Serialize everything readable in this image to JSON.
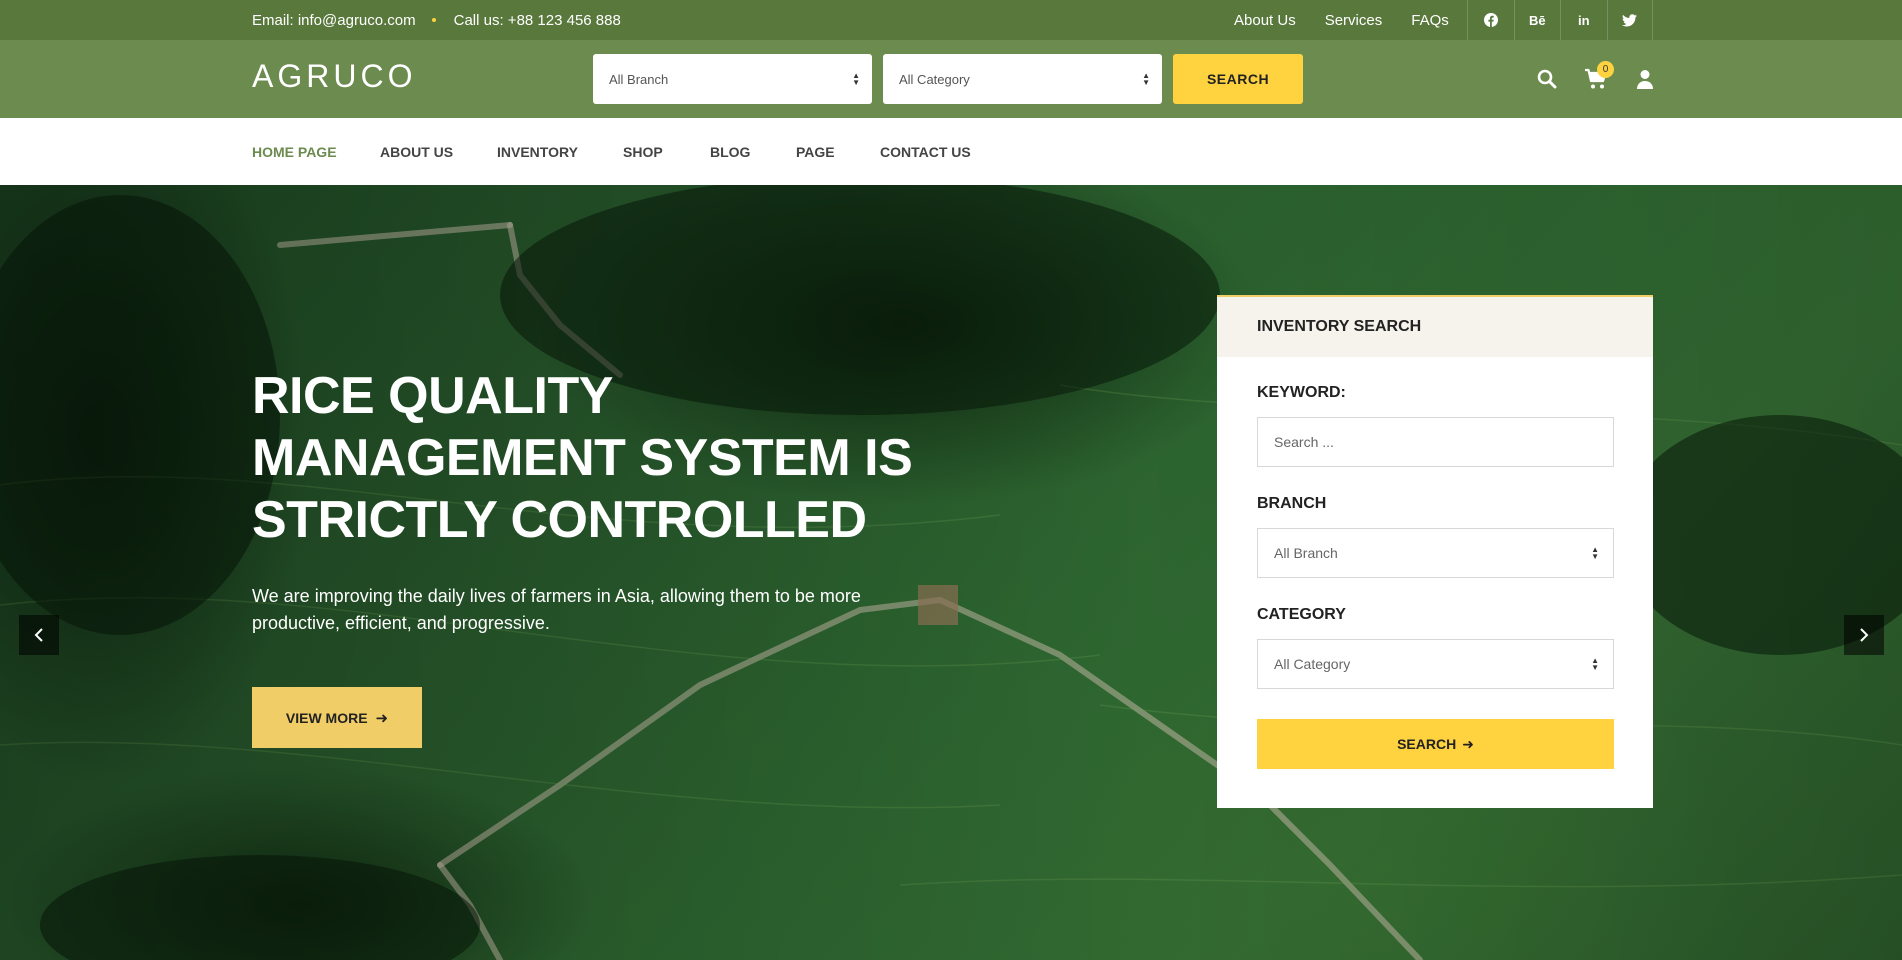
{
  "topbar": {
    "email": "Email: info@agruco.com",
    "phone": "Call us: +88 123 456 888",
    "links": [
      "About Us",
      "Services",
      "FAQs"
    ],
    "social": [
      {
        "name": "facebook-icon",
        "glyph": "f"
      },
      {
        "name": "behance-icon",
        "glyph": "Bē"
      },
      {
        "name": "linkedin-icon",
        "glyph": "in"
      },
      {
        "name": "twitter-icon",
        "glyph": "t"
      }
    ]
  },
  "header": {
    "logo": "AGRUCO",
    "branch_select": "All Branch",
    "category_select": "All Category",
    "search_label": "SEARCH",
    "cart_count": "0"
  },
  "nav": {
    "items": [
      "HOME PAGE",
      "ABOUT US",
      "INVENTORY",
      "SHOP",
      "BLOG",
      "PAGE",
      "CONTACT US"
    ],
    "active": "HOME PAGE"
  },
  "hero": {
    "title_lines": [
      "RICE QUALITY",
      "MANAGEMENT SYSTEM IS",
      "STRICTLY CONTROLLED"
    ],
    "text": "We are improving the daily lives of farmers in Asia, allowing them to be more productive, efficient, and progressive.",
    "button_label": "VIEW MORE"
  },
  "inventory_search": {
    "title": "INVENTORY SEARCH",
    "keyword_label": "KEYWORD:",
    "keyword_placeholder": "Search ...",
    "branch_label": "BRANCH",
    "branch_value": "All Branch",
    "category_label": "CATEGORY",
    "category_value": "All Category",
    "button_label": "SEARCH"
  },
  "colors": {
    "topbar": "#58783c",
    "header": "#6c8b4f",
    "accent_yellow": "#ffd23f",
    "button_yellow": "#f1cd67"
  }
}
